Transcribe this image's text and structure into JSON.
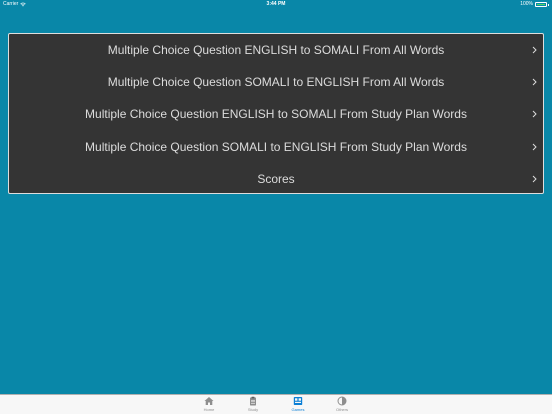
{
  "status_bar": {
    "carrier": "Carrier",
    "time": "3:44 PM",
    "battery_percent_label": "100%",
    "battery_level": 1.0
  },
  "menu": {
    "items": [
      {
        "label": "Multiple Choice Question ENGLISH to SOMALI From All Words"
      },
      {
        "label": "Multiple Choice Question SOMALI to ENGLISH From All Words"
      },
      {
        "label": "Multiple Choice Question ENGLISH to SOMALI From Study Plan Words"
      },
      {
        "label": "Multiple Choice Question SOMALI to ENGLISH From Study Plan Words"
      },
      {
        "label": "Scores"
      }
    ]
  },
  "tab_bar": {
    "tabs": [
      {
        "label": "Home",
        "icon": "home-icon"
      },
      {
        "label": "Study",
        "icon": "clipboard-icon"
      },
      {
        "label": "Games",
        "icon": "games-icon",
        "active": true
      },
      {
        "label": "Others",
        "icon": "half-circle-icon"
      }
    ]
  },
  "colors": {
    "background": "#0987a8",
    "panel": "#343434",
    "panel_border": "#dddddd",
    "menu_text": "#dcdcdc",
    "tab_active": "#0a7fd6",
    "tab_inactive": "#8e8e8e",
    "battery_fill": "#4cd964"
  }
}
